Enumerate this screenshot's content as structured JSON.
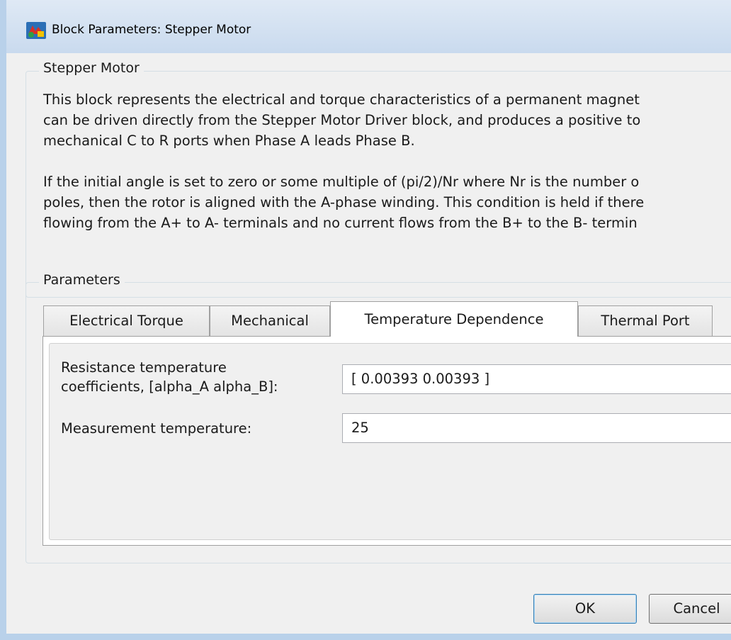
{
  "window": {
    "title": "Block Parameters: Stepper Motor",
    "app_icon": "simulink-block-icon"
  },
  "description_group": {
    "label": "Stepper Motor",
    "lines": [
      "This block represents the electrical and torque characteristics of a permanent magnet",
      "can be driven directly from the Stepper Motor Driver block, and produces a positive to",
      "mechanical C to R ports when Phase A leads Phase B.",
      "",
      "If the initial angle is set to zero or some multiple of (pi/2)/Nr where Nr is the number o",
      "poles, then the rotor is aligned with the A-phase winding. This condition is held if there",
      "flowing from the A+ to A- terminals and no current flows from the B+ to the B- termin"
    ]
  },
  "parameters_group": {
    "label": "Parameters",
    "tabs": [
      {
        "label": "Electrical Torque",
        "active": false
      },
      {
        "label": "Mechanical",
        "active": false
      },
      {
        "label": "Temperature Dependence",
        "active": true
      },
      {
        "label": "Thermal Port",
        "active": false
      }
    ],
    "fields": [
      {
        "label_line1": "Resistance temperature",
        "label_line2": "coefficients, [alpha_A alpha_B]:",
        "value": "[ 0.00393 0.00393 ]"
      },
      {
        "label": "Measurement temperature:",
        "value": "25"
      }
    ]
  },
  "buttons": {
    "ok": "OK",
    "cancel": "Cancel"
  }
}
